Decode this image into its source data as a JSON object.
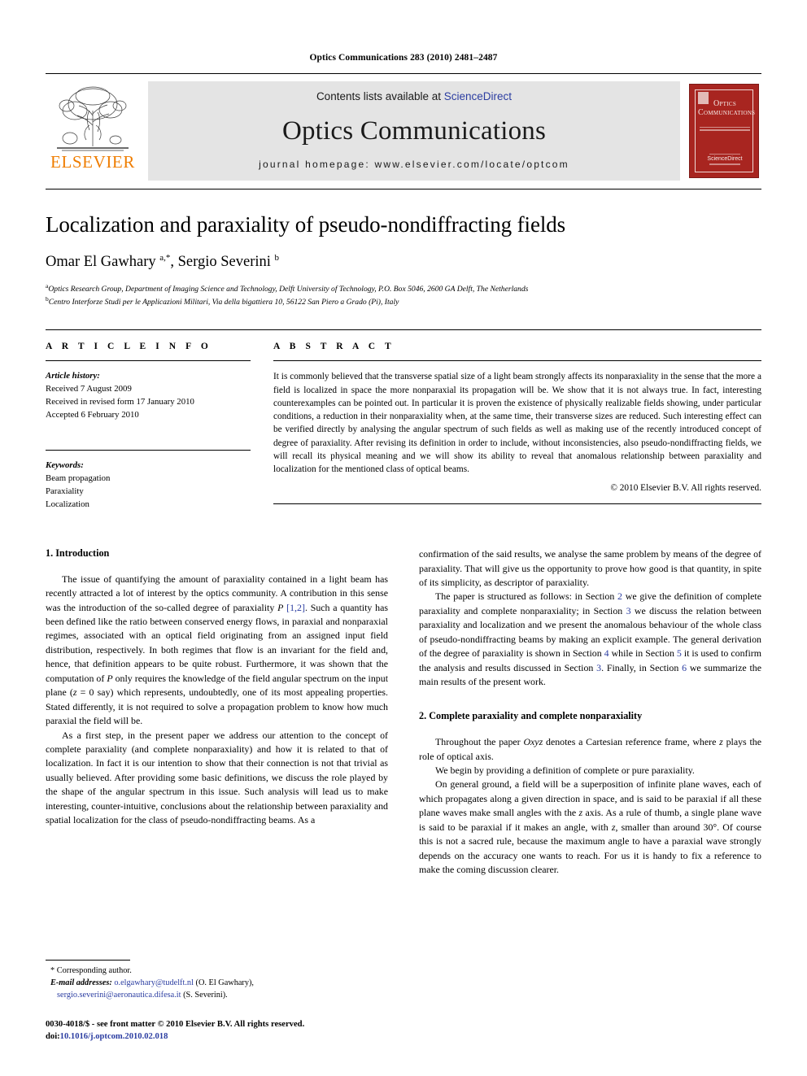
{
  "running_head": "Optics Communications 283 (2010) 2481–2487",
  "masthead": {
    "contents_prefix": "Contents lists available at ",
    "sciencedirect": "ScienceDirect",
    "journal_name": "Optics Communications",
    "homepage": "journal homepage: www.elsevier.com/locate/optcom",
    "publisher_wordmark": "ELSEVIER",
    "cover_title": "Optics Communications",
    "accent_blue": "#2b3da1",
    "cover_red": "#a82520",
    "elsevier_orange": "#ef7d00",
    "band_gray": "#e4e4e4"
  },
  "article": {
    "title": "Localization and paraxiality of pseudo-nondiffracting fields",
    "authors_html": "Omar El Gawhary <sup>a,*</sup>, Sergio Severini <sup>b</sup>",
    "affiliation_a": "Optics Research Group, Department of Imaging Science and Technology, Delft University of Technology, P.O. Box 5046, 2600 GA Delft, The Netherlands",
    "affiliation_b": "Centro Interforze Studi per le Applicazioni Militari, Via della bigattiera 10, 56122 San Piero a Grado (Pi), Italy"
  },
  "article_info": {
    "label": "A R T I C L E    I N F O",
    "history_head": "Article history:",
    "history": [
      "Received 7 August 2009",
      "Received in revised form 17 January 2010",
      "Accepted 6 February 2010"
    ],
    "keywords_head": "Keywords:",
    "keywords": [
      "Beam propagation",
      "Paraxiality",
      "Localization"
    ]
  },
  "abstract": {
    "label": "A B S T R A C T",
    "text": "It is commonly believed that the transverse spatial size of a light beam strongly affects its nonparaxiality in the sense that the more a field is localized in space the more nonparaxial its propagation will be. We show that it is not always true. In fact, interesting counterexamples can be pointed out. In particular it is proven the existence of physically realizable fields showing, under particular conditions, a reduction in their nonparaxiality when, at the same time, their transverse sizes are reduced. Such interesting effect can be verified directly by analysing the angular spectrum of such fields as well as making use of the recently introduced concept of degree of paraxiality. After revising its definition in order to include, without inconsistencies, also pseudo-nondiffracting fields, we will recall its physical meaning and we will show its ability to reveal that anomalous relationship between paraxiality and localization for the mentioned class of optical beams.",
    "copyright": "© 2010 Elsevier B.V. All rights reserved."
  },
  "body": {
    "section1_head": "1. Introduction",
    "p1_html": "The issue of quantifying the amount of paraxiality contained in a light beam has recently attracted a lot of interest by the optics community. A contribution in this sense was the introduction of the so-called degree of paraxiality <em class=\"it\">P</em> <span class=\"ref\">[1,2]</span>. Such a quantity has been defined like the ratio between conserved energy flows, in paraxial and nonparaxial regimes, associated with an optical field originating from an assigned input field distribution, respectively. In both regimes that flow is an invariant for the field and, hence, that definition appears to be quite robust. Furthermore, it was shown that the computation of <em class=\"it\">P</em> only requires the knowledge of the field angular spectrum on the input plane (<em class=\"it\">z</em> = 0 say) which represents, undoubtedly, one of its most appealing properties. Stated differently, it is not required to solve a propagation problem to know how much paraxial the field will be.",
    "p2_html": "As a first step, in the present paper we address our attention to the concept of complete paraxiality (and complete nonparaxiality) and how it is related to that of localization. In fact it is our intention to show that their connection is not that trivial as usually believed. After providing some basic definitions, we discuss the role played by the shape of the angular spectrum in this issue. Such analysis will lead us to make interesting, counter-intuitive, conclusions about the relationship between paraxiality and spatial localization for the class of pseudo-nondiffracting beams. As a",
    "p2_cont_html": "confirmation of the said results, we analyse the same problem by means of the degree of paraxiality. That will give us the opportunity to prove how good is that quantity, in spite of its simplicity, as descriptor of paraxiality.",
    "p3_html": "The paper is structured as follows: in Section <span class=\"ref\">2</span> we give the definition of complete paraxiality and complete nonparaxiality; in Section <span class=\"ref\">3</span> we discuss the relation between paraxiality and localization and we present the anomalous behaviour of the whole class of pseudo-nondiffracting beams by making an explicit example. The general derivation of the degree of paraxiality is shown in Section <span class=\"ref\">4</span> while in Section <span class=\"ref\">5</span> it is used to confirm the analysis and results discussed in Section <span class=\"ref\">3</span>. Finally, in Section <span class=\"ref\">6</span> we summarize the main results of the present work.",
    "section2_head": "2. Complete paraxiality and complete nonparaxiality",
    "p4_html": "Throughout the paper <em class=\"it\">Oxyz</em> denotes a Cartesian reference frame, where <em class=\"it\">z</em> plays the role of optical axis.",
    "p5_html": "We begin by providing a definition of complete or pure paraxiality.",
    "p6_html": "On general ground, a field will be a superposition of infinite plane waves, each of which propagates along a given direction in space, and is said to be paraxial if all these plane waves make small angles with the <em class=\"it\">z</em> axis. As a rule of thumb, a single plane wave is said to be paraxial if it makes an angle, with <em class=\"it\">z</em>, smaller than around 30°. Of course this is not a sacred rule, because the maximum angle to have a paraxial wave strongly depends on the accuracy one wants to reach. For us it is handy to fix a reference to make the coming discussion clearer."
  },
  "footnotes": {
    "corresponding": "* Corresponding author.",
    "email_label": "E-mail addresses:",
    "email_1": "o.elgawhary@tudelft.nl",
    "email_1_owner": "(O. El Gawhary),",
    "email_2": "sergio.severini@aeronautica.difesa.it",
    "email_2_owner": "(S. Severini).",
    "issn_line": "0030-4018/$ - see front matter © 2010 Elsevier B.V. All rights reserved.",
    "doi_label": "doi:",
    "doi_value": "10.1016/j.optcom.2010.02.018"
  }
}
